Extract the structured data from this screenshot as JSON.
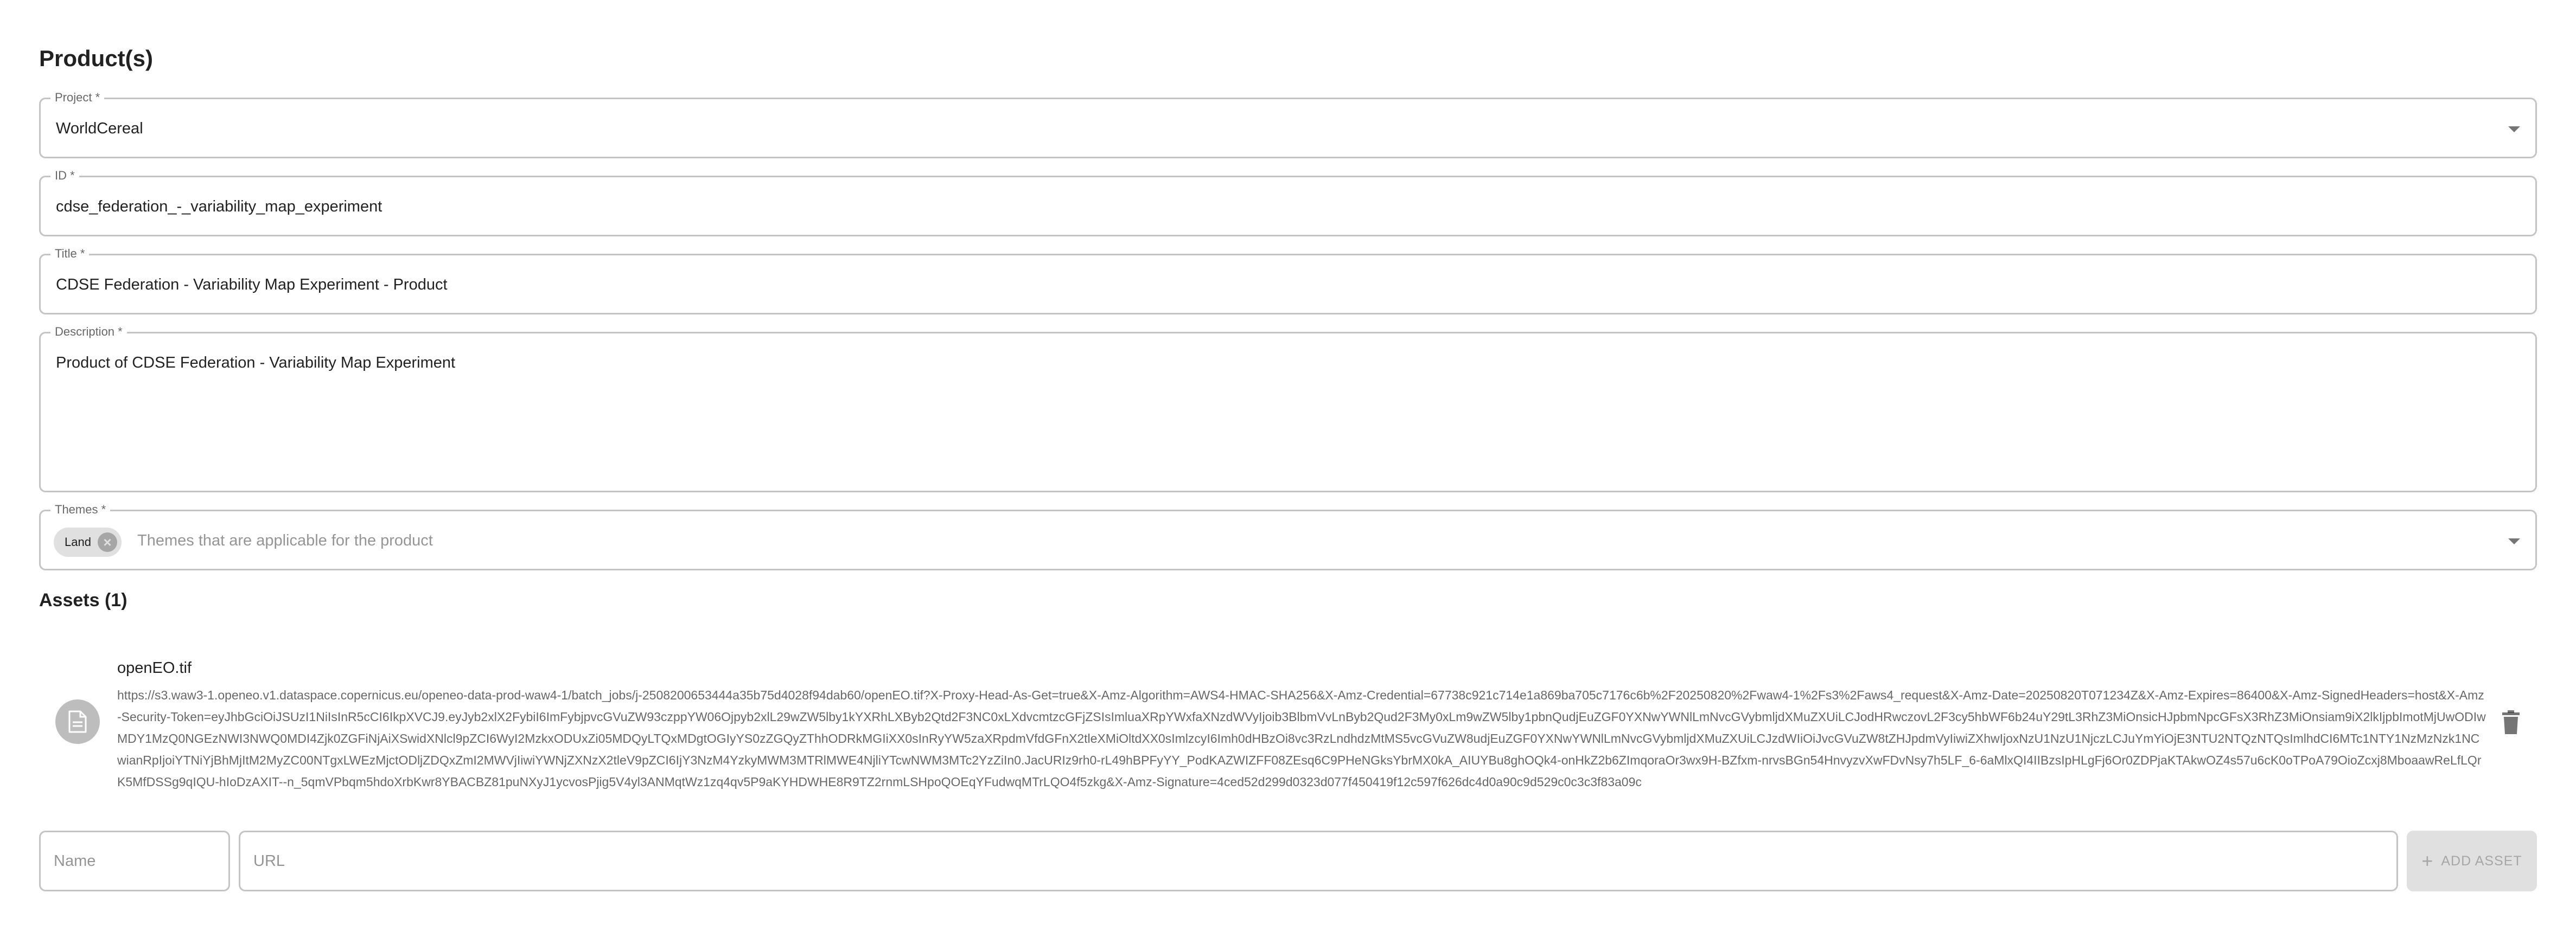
{
  "sections": {
    "products_title": "Product(s)",
    "assets_title": "Assets (1)"
  },
  "fields": {
    "project": {
      "label": "Project *",
      "value": "WorldCereal"
    },
    "id": {
      "label": "ID *",
      "value": "cdse_federation_-_variability_map_experiment"
    },
    "title": {
      "label": "Title *",
      "value": "CDSE Federation - Variability Map Experiment - Product"
    },
    "description": {
      "label": "Description *",
      "value": "Product of CDSE Federation - Variability Map Experiment"
    },
    "themes": {
      "label": "Themes *",
      "chips": [
        "Land"
      ],
      "placeholder": "Themes that are applicable for the product"
    }
  },
  "assets": [
    {
      "name": "openEO.tif",
      "url": "https://s3.waw3-1.openeo.v1.dataspace.copernicus.eu/openeo-data-prod-waw4-1/batch_jobs/j-2508200653444a35b75d4028f94dab60/openEO.tif?X-Proxy-Head-As-Get=true&X-Amz-Algorithm=AWS4-HMAC-SHA256&X-Amz-Credential=67738c921c714e1a869ba705c7176c6b%2F20250820%2Fwaw4-1%2Fs3%2Faws4_request&X-Amz-Date=20250820T071234Z&X-Amz-Expires=86400&X-Amz-SignedHeaders=host&X-Amz-Security-Token=eyJhbGciOiJSUzI1NiIsInR5cCI6IkpXVCJ9.eyJyb2xlX2FybiI6ImFybjpvcGVuZW93czppYW06Ojpyb2xlL29wZW5lby1kYXRhLXByb2Qtd2F3NC0xLXdvcmtzcGFjZSIsImluaXRpYWxfaXNzdWVyIjoib3BlbmVvLnByb2Qud2F3My0xLm9wZW5lby1pbnQudjEuZGF0YXNwYWNlLmNvcGVybmljdXMuZXUiLCJodHRwczovL2F3cy5hbWF6b24uY29tL3RhZ3MiOnsicHJpbmNpcGFsX3RhZ3MiOnsiam9iX2lkIjpbImotMjUwODIwMDY1MzQ0NGEzNWI3NWQ0MDI4Zjk0ZGFiNjAiXSwidXNlcl9pZCI6WyI2MzkxODUxZi05MDQyLTQxMDgtOGIyYS0zZGQyZThhODRkMGIiXX0sInRyYW5zaXRpdmVfdGFnX2tleXMiOltdXX0sImlzcyI6Imh0dHBzOi8vc3RzLndhdzMtMS5vcGVuZW8udjEuZGF0YXNwYWNlLmNvcGVybmljdXMuZXUiLCJzdWIiOiJvcGVuZW8tZHJpdmVyIiwiZXhwIjoxNzU1NzU1NjczLCJuYmYiOjE3NTU2NTQzNTQsImlhdCI6MTc1NTY1NzMzNzk1NCwianRpIjoiYTNiYjBhMjItM2MyZC00NTgxLWEzMjctODljZDQxZmI2MWVjIiwiYWNjZXNzX2tleV9pZCI6IjY3NzM4YzkyMWM3MTRlMWE4NjliYTcwNWM3MTc2YzZiIn0.JacURIz9rh0-rL49hBPFyYY_PodKAZWIZFF08ZEsq6C9PHeNGksYbrMX0kA_AIUYBu8ghOQk4-onHkZ2b6ZImqoraOr3wx9H-BZfxm-nrvsBGn54HnvyzvXwFDvNsy7h5LF_6-6aMlxQI4IIBzsIpHLgFj6Or0ZDPjaKTAkwOZ4s57u6cK0oTPoA79OioZcxj8MboaawReLfLQrK5MfDSSg9qIQU-hIoDzAXIT--n_5qmVPbqm5hdoXrbKwr8YBACBZ81puNXyJ1ycvosPjig5V4yl3ANMqtWz1zq4qv5P9aKYHDWHE8R9TZ2rnmLSHpoQOEqYFudwqMTrLQO4f5zkg&X-Amz-Signature=4ced52d299d0323d077f450419f12c597f626dc4d0a90c9d529c0c3c3f83a09c"
    }
  ],
  "new_asset": {
    "name_placeholder": "Name",
    "url_placeholder": "URL",
    "add_label": "ADD ASSET"
  },
  "icons": {
    "dropdown": "arrow-drop-down-icon",
    "chip_delete": "cancel-icon",
    "asset": "file-icon",
    "delete": "trash-icon",
    "add": "plus-icon"
  },
  "colors": {
    "border": "#c4c4c4",
    "chip_bg": "#e0e0e0",
    "avatar_bg": "#bdbdbd",
    "disabled_btn_bg": "#e0e0e0"
  }
}
